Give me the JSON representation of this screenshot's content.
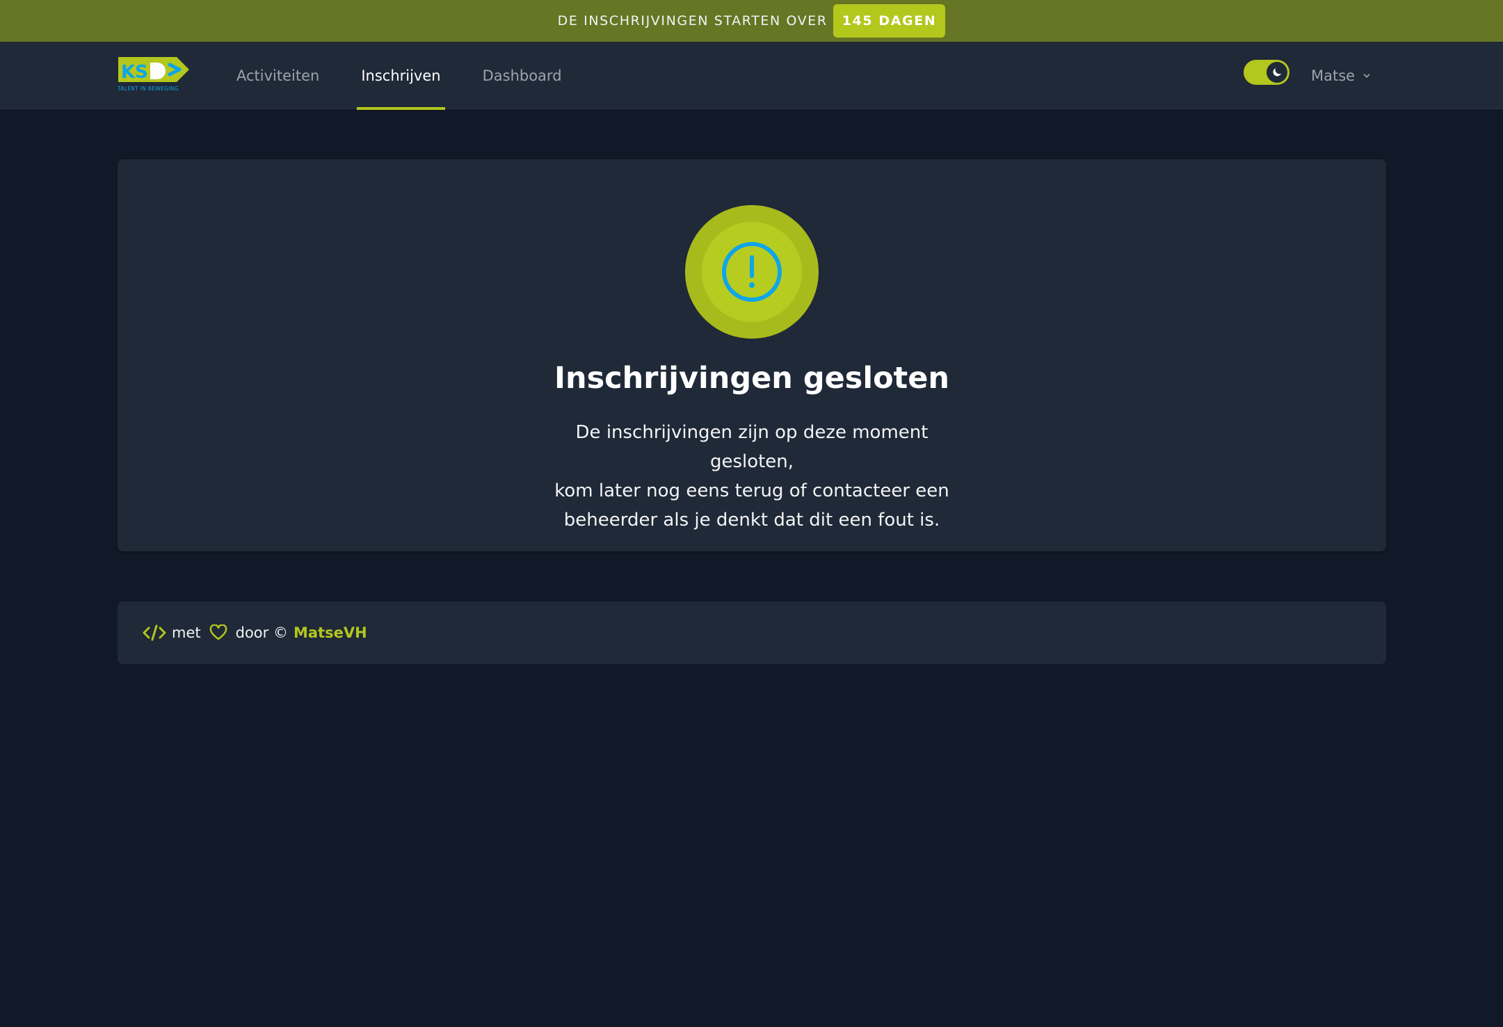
{
  "banner": {
    "text": "DE INSCHRIJVINGEN STARTEN OVER",
    "badge": "145 DAGEN"
  },
  "logo": {
    "letters": "KSD",
    "tagline": "TALENT IN BEWEGING"
  },
  "nav": {
    "items": [
      {
        "label": "Activiteiten",
        "active": false
      },
      {
        "label": "Inschrijven",
        "active": true
      },
      {
        "label": "Dashboard",
        "active": false
      }
    ]
  },
  "theme_toggle": {
    "icon": "moon-icon",
    "state": "dark"
  },
  "user": {
    "name": "Matse",
    "icon": "chevron-down-icon"
  },
  "card": {
    "icon": "exclamation-circle-icon",
    "title": "Inschrijvingen gesloten",
    "lines": [
      "De inschrijvingen zijn op deze moment gesloten,",
      "kom later nog eens terug of contacteer een",
      "beheerder als je denkt dat dit een fout is."
    ]
  },
  "footer": {
    "code_icon": "code-icon",
    "met": "met",
    "heart_icon": "heart-icon",
    "door": "door ©",
    "author": "MatseVH"
  },
  "colors": {
    "accent": "#b3c71d",
    "banner_bg": "#677624",
    "page_bg": "#111827",
    "card_bg": "#1f2937",
    "icon_blue": "#0ea5e9"
  }
}
